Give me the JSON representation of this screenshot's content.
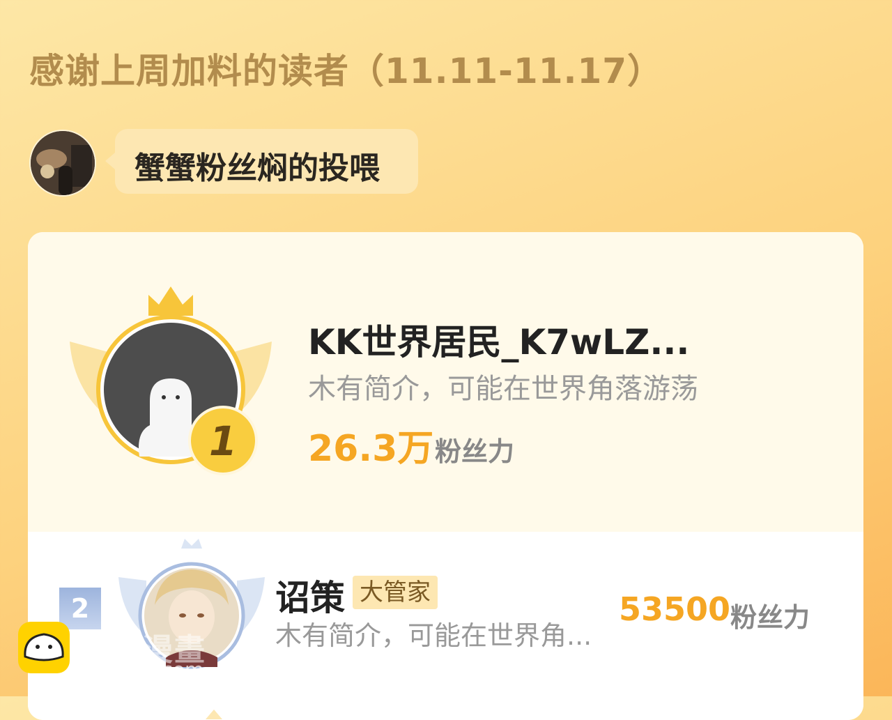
{
  "header": {
    "title": "感谢上周加料的读者（11.11-11.17）"
  },
  "feeder": {
    "label": "蟹蟹粉丝焖的投喂"
  },
  "ranking": {
    "first": {
      "rank": "1",
      "name": "KK世界居民_K7wLZ...",
      "bio": "木有简介，可能在世界角落游荡",
      "fans_value": "26.3万",
      "fans_label": "粉丝力"
    },
    "second": {
      "rank": "2",
      "name": "诏策",
      "tag": "大管家",
      "bio": "木有简介，可能在世界角...",
      "fans_value": "53500",
      "fans_label": "粉丝力"
    }
  },
  "watermark": {
    "name": "包子漫畫",
    "url": "baozimh.com"
  },
  "colors": {
    "accent": "#f5a623",
    "title": "#b28c4d",
    "gold": "#f7c53a",
    "silver": "#a9bde0"
  }
}
